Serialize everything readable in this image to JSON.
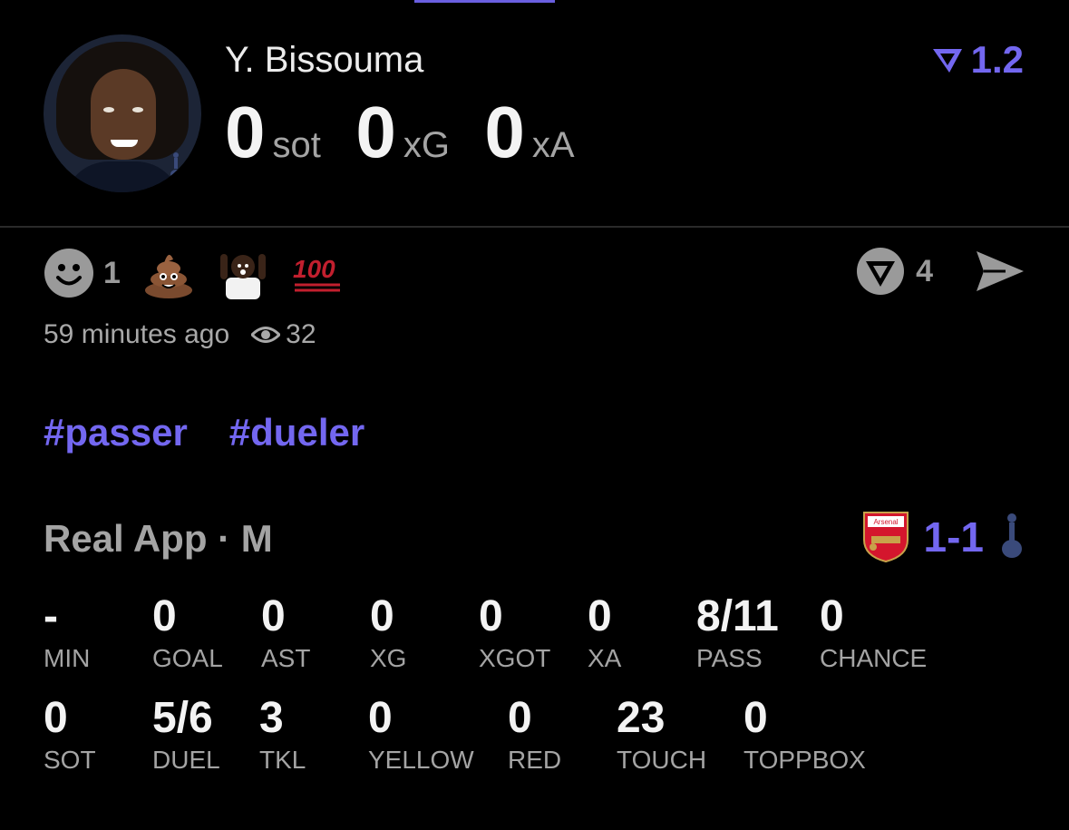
{
  "player": {
    "name": "Y. Bissouma",
    "big_stats": [
      {
        "value": "0",
        "unit": "sot"
      },
      {
        "value": "0",
        "unit": "xG"
      },
      {
        "value": "0",
        "unit": "xA"
      }
    ],
    "rating": "1.2"
  },
  "reactions": {
    "smile_count": "1",
    "emoji_icons": [
      "poop-emoji-icon",
      "shocked-person-emoji-icon",
      "hundred-points-emoji-icon"
    ],
    "votes_count": "4"
  },
  "meta": {
    "time_ago": "59 minutes ago",
    "views": "32"
  },
  "tags": [
    "#passer",
    "#dueler"
  ],
  "match": {
    "label": "Real App · M",
    "score": "1-1"
  },
  "stats_row1": [
    {
      "value": "-",
      "label": "MIN"
    },
    {
      "value": "0",
      "label": "GOAL"
    },
    {
      "value": "0",
      "label": "AST"
    },
    {
      "value": "0",
      "label": "XG"
    },
    {
      "value": "0",
      "label": "XGOT"
    },
    {
      "value": "0",
      "label": "XA"
    },
    {
      "value": "8/11",
      "label": "PASS"
    },
    {
      "value": "0",
      "label": "CHANCE"
    }
  ],
  "stats_row2": [
    {
      "value": "0",
      "label": "SOT"
    },
    {
      "value": "5/6",
      "label": "DUEL"
    },
    {
      "value": "3",
      "label": "TKL"
    },
    {
      "value": "0",
      "label": "YELLOW"
    },
    {
      "value": "0",
      "label": "RED"
    },
    {
      "value": "23",
      "label": "TOUCH"
    },
    {
      "value": "0",
      "label": "TOPPBOX"
    }
  ],
  "colors": {
    "accent": "#7367f0",
    "background": "#000000",
    "muted": "#a4a4a4"
  }
}
